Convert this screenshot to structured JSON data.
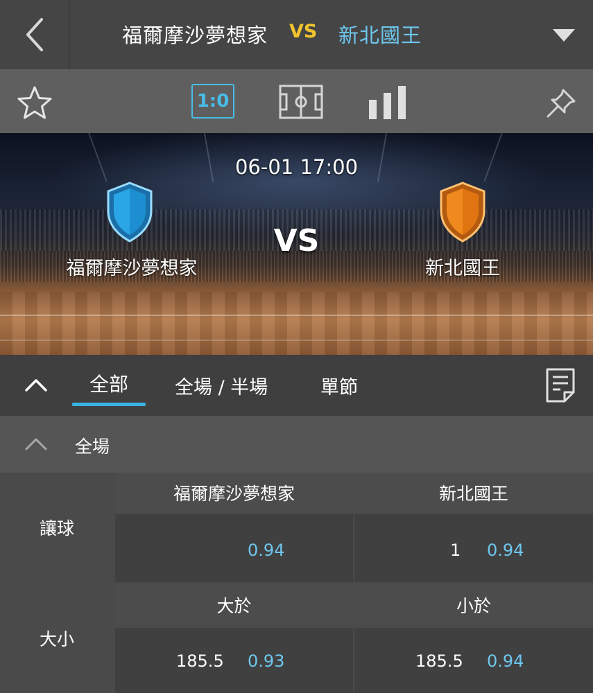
{
  "header": {
    "home_team": "福爾摩沙夢想家",
    "vs": "VS",
    "away_team": "新北國王",
    "colors": {
      "vs": "#f2c42d",
      "away": "#6ec7ef"
    }
  },
  "toolbar": {
    "score_label": "1:0",
    "icons": [
      "star-icon",
      "score-icon",
      "court-icon",
      "stats-icon",
      "pin-icon"
    ],
    "accent": "#47bde8"
  },
  "match": {
    "time": "06-01 17:00",
    "vs": "VS",
    "home_team": "福爾摩沙夢想家",
    "away_team": "新北國王",
    "home_shield_color": "#2aa6e6",
    "away_shield_color": "#f08a1f"
  },
  "tabs": {
    "items": [
      "全部",
      "全場 / 半場",
      "單節"
    ],
    "active": "全部"
  },
  "section": {
    "title": "全場"
  },
  "markets": [
    {
      "label": "讓球",
      "headers": [
        "福爾摩沙夢想家",
        "新北國王"
      ],
      "cells": [
        {
          "line": "",
          "odds": "0.94"
        },
        {
          "line": "1",
          "odds": "0.94"
        }
      ]
    },
    {
      "label": "大小",
      "headers": [
        "大於",
        "小於"
      ],
      "cells": [
        {
          "line": "185.5",
          "odds": "0.93"
        },
        {
          "line": "185.5",
          "odds": "0.94"
        }
      ]
    }
  ]
}
